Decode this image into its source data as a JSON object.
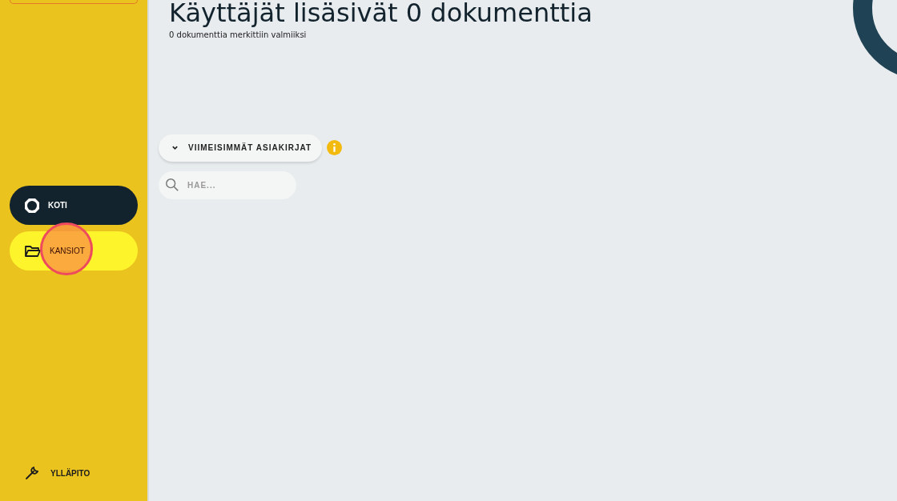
{
  "nav": [
    {
      "label": "KOTI",
      "kind": "home",
      "selected": true,
      "highlighted": false
    },
    {
      "label": "KANSIOT",
      "kind": "folder",
      "selected": false,
      "highlighted": true
    }
  ],
  "footer_item": {
    "label": "YLLÄPITO"
  },
  "click_marker": {
    "visible": true
  },
  "heading": {
    "title": "Käyttäjät lisäsivät 0 dokumenttia",
    "subtitle": "0 dokumenttia merkittiin valmiiksi"
  },
  "recent_toggle": {
    "label": "VIIMEISIMMÄT ASIAKIRJAT",
    "expanded": true
  },
  "search": {
    "placeholder": "HAE..."
  }
}
